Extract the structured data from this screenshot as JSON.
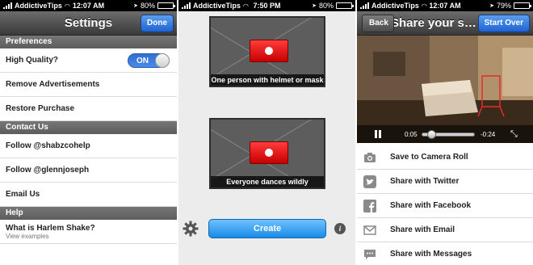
{
  "status_bars": [
    {
      "carrier": "AddictiveTips",
      "time": "12:07 AM",
      "battery": "80%",
      "battery_level": 0.8
    },
    {
      "carrier": "AddictiveTips",
      "time": "7:50 PM",
      "battery": "80%",
      "battery_level": 0.8
    },
    {
      "carrier": "AddictiveTips",
      "time": "12:07 AM",
      "battery": "79%",
      "battery_level": 0.79
    }
  ],
  "settings": {
    "title": "Settings",
    "done_label": "Done",
    "sections": {
      "preferences": "Preferences",
      "contact": "Contact Us",
      "help": "Help"
    },
    "high_quality_label": "High Quality?",
    "toggle_on": "ON",
    "remove_ads": "Remove Advertisements",
    "restore": "Restore Purchase",
    "follow_1": "Follow @shabzcohelp",
    "follow_2": "Follow @glennjoseph",
    "email_us": "Email Us",
    "what_is": "What is Harlem Shake?",
    "view_examples": "View examples"
  },
  "recorder": {
    "clip_1_caption": "One person with helmet or mask",
    "clip_2_caption": "Everyone dances wildly",
    "create_label": "Create",
    "info_glyph": "i"
  },
  "share": {
    "title": "Share your sha...",
    "back_label": "Back",
    "start_over_label": "Start Over",
    "elapsed": "0:05",
    "remaining": "-0:24",
    "progress": 0.17,
    "items": [
      {
        "label": "Save to Camera Roll",
        "icon": "camera-icon"
      },
      {
        "label": "Share with Twitter",
        "icon": "twitter-icon"
      },
      {
        "label": "Share with Facebook",
        "icon": "facebook-icon"
      },
      {
        "label": "Share with Email",
        "icon": "mail-icon"
      },
      {
        "label": "Share with Messages",
        "icon": "messages-icon"
      }
    ]
  }
}
